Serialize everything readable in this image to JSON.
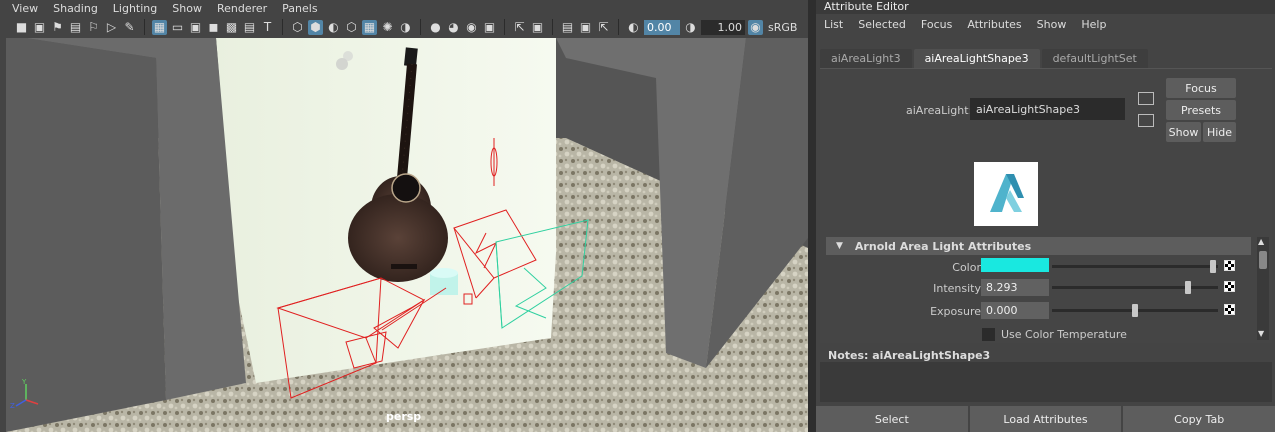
{
  "viewport": {
    "menus": [
      "View",
      "Shading",
      "Lighting",
      "Show",
      "Renderer",
      "Panels"
    ],
    "exposure_value": "0.00",
    "gamma_value": "1.00",
    "colorspace_label": "sRGB",
    "camera_label": "persp",
    "axis_labels": {
      "x": "X",
      "y": "Y",
      "z": "Z"
    }
  },
  "attribute_editor": {
    "title": "Attribute Editor",
    "menus": [
      "List",
      "Selected",
      "Focus",
      "Attributes",
      "Show",
      "Help"
    ],
    "tabs": [
      {
        "label": "aiAreaLight3",
        "active": false
      },
      {
        "label": "aiAreaLightShape3",
        "active": true
      },
      {
        "label": "defaultLightSet",
        "active": false
      }
    ],
    "node_label": "aiAreaLight:",
    "node_name": "aiAreaLightShape3",
    "buttons": {
      "focus": "Focus",
      "presets": "Presets",
      "show": "Show",
      "hide": "Hide"
    },
    "section_title": "Arnold Area Light Attributes",
    "attributes": {
      "color": {
        "label": "Color",
        "value_hex": "#19e8e0",
        "slider": 0.97
      },
      "intensity": {
        "label": "Intensity",
        "value": "8.293",
        "slider": 0.82
      },
      "exposure": {
        "label": "Exposure",
        "value": "0.000",
        "slider": 0.5
      }
    },
    "use_color_temperature": {
      "label": "Use Color Temperature",
      "checked": false
    },
    "notes_label": "Notes:  aiAreaLightShape3",
    "bottom_buttons": {
      "select": "Select",
      "load_attributes": "Load Attributes",
      "copy_tab": "Copy Tab"
    }
  },
  "colors": {
    "accent": "#5285a6",
    "light_wire": "#e02020",
    "selected_wire": "#30d0a0"
  }
}
